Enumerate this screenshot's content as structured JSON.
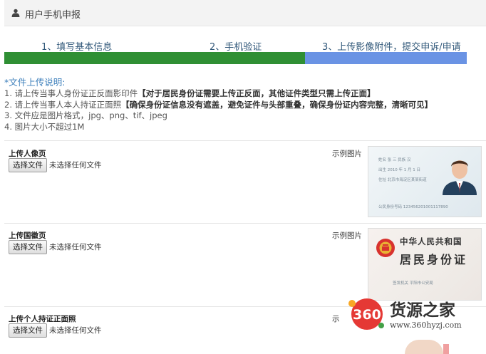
{
  "header": {
    "title": "用户手机申报",
    "icon": "user-icon"
  },
  "steps": [
    {
      "label": "1、填写基本信息"
    },
    {
      "label": "2、手机验证"
    },
    {
      "label": "3、上传影像附件，提交申诉/申请"
    }
  ],
  "progress": {
    "completed_fraction": 0.65,
    "current_step": 3,
    "colors": {
      "done": "#2f8f34",
      "current": "#6a93e4"
    }
  },
  "notes": {
    "heading": "*文件上传说明:",
    "line1_prefix": "1. 请上传当事人身份证正反面影印件",
    "line1_strong": "【对于居民身份证需要上传正反面，其他证件类型只需上传正面】",
    "line2_prefix": "2. 请上传当事人本人持证正面照",
    "line2_strong": "【确保身份证信息没有遮盖，避免证件与头部重叠，确保身份证内容完整，清晰可见】",
    "line3": "3. 文件应是图片格式，jpg、png、tif、jpeg",
    "line4": "4. 图片大小不超过1M"
  },
  "uploads": [
    {
      "label": "上传人像页",
      "button": "选择文件",
      "status": "未选择任何文件",
      "sample": "示例图片"
    },
    {
      "label": "上传国徽页",
      "button": "选择文件",
      "status": "未选择任何文件",
      "sample": "示例图片"
    },
    {
      "label": "上传个人持证正面照",
      "button": "选择文件",
      "status": "未选择任何文件",
      "sample": "示"
    }
  ],
  "sample_front": {
    "tiny1": "姓名 张 三 民族 汉",
    "tiny2": "出生 2010 年 1 月 1 日",
    "tiny3": "住址 北京市海淀区某某街道",
    "id_line": "公民身份号码 123456201001117890"
  },
  "sample_back": {
    "country": "中华人民共和国",
    "doc": "居民身份证",
    "issuer": "签发机关 平阳市公安局"
  },
  "watermark": {
    "badge": "360",
    "title": "货源之家",
    "url": "www.360hyzj.com"
  }
}
